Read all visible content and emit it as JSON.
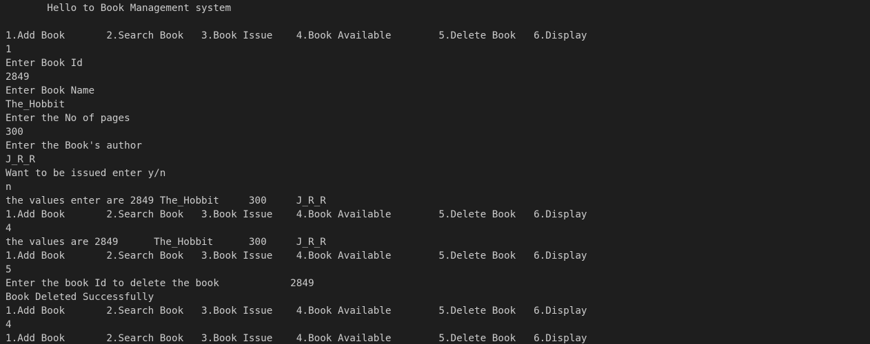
{
  "terminal": {
    "lines": [
      "       Hello to Book Management system",
      "",
      "1.Add Book       2.Search Book   3.Book Issue    4.Book Available        5.Delete Book   6.Display",
      "1",
      "Enter Book Id",
      "2849",
      "Enter Book Name",
      "The_Hobbit",
      "Enter the No of pages",
      "300",
      "Enter the Book's author",
      "J_R_R",
      "Want to be issued enter y/n",
      "n",
      "the values enter are 2849 The_Hobbit     300     J_R_R",
      "1.Add Book       2.Search Book   3.Book Issue    4.Book Available        5.Delete Book   6.Display",
      "4",
      "the values are 2849      The_Hobbit      300     J_R_R",
      "1.Add Book       2.Search Book   3.Book Issue    4.Book Available        5.Delete Book   6.Display",
      "5",
      "Enter the book Id to delete the book            2849",
      "Book Deleted Successfully",
      "1.Add Book       2.Search Book   3.Book Issue    4.Book Available        5.Delete Book   6.Display",
      "4",
      "1.Add Book       2.Search Book   3.Book Issue    4.Book Available        5.Delete Book   6.Display"
    ]
  },
  "colors": {
    "background": "#1e1e1e",
    "text": "#cccccc"
  }
}
